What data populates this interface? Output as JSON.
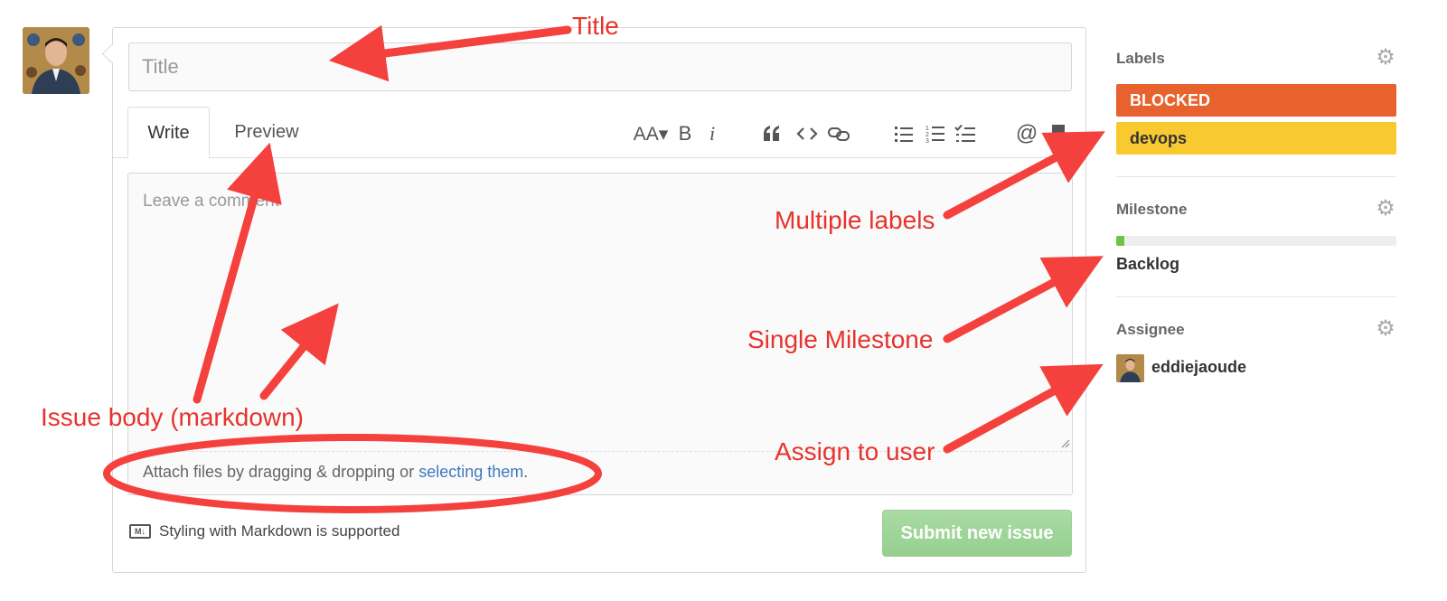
{
  "form": {
    "title_placeholder": "Title",
    "tabs": [
      {
        "label": "Write"
      },
      {
        "label": "Preview"
      }
    ],
    "toolbar": {
      "text_size": "AA▾",
      "bold": "B",
      "italic": "i",
      "mention": "@"
    },
    "comment_placeholder": "Leave a comment",
    "attach_prefix": "Attach files by dragging & dropping or ",
    "attach_link": "selecting them",
    "attach_suffix": ".",
    "markdown_note": "Styling with Markdown is supported",
    "markdown_badge": "M↓",
    "submit_label": "Submit new issue"
  },
  "sidebar": {
    "labels": {
      "heading": "Labels",
      "items": [
        {
          "name": "BLOCKED",
          "color": "#e8622d"
        },
        {
          "name": "devops",
          "color": "#f9c930"
        }
      ]
    },
    "milestone": {
      "heading": "Milestone",
      "name": "Backlog",
      "progress_percent": 3
    },
    "assignee": {
      "heading": "Assignee",
      "user": "eddiejaoude"
    }
  },
  "annotations": {
    "title": "Title",
    "multiple_labels": "Multiple labels",
    "single_milestone": "Single Milestone",
    "assign_user": "Assign to user",
    "issue_body": "Issue body (markdown)",
    "color": "#e8322c"
  }
}
